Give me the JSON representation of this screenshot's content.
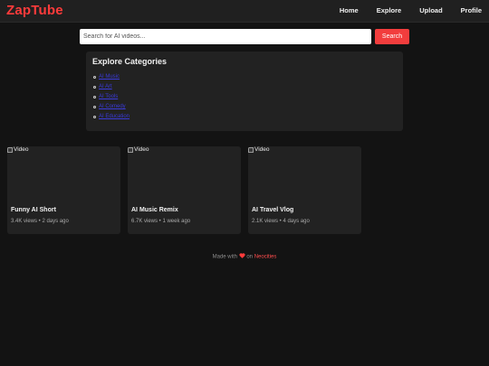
{
  "header": {
    "logo": "ZapTube",
    "nav": [
      "Home",
      "Explore",
      "Upload",
      "Profile"
    ]
  },
  "search": {
    "placeholder": "Search for AI videos...",
    "value": "",
    "button_label": "Search"
  },
  "categories": {
    "title": "Explore Categories",
    "items": [
      "AI Music",
      "AI Art",
      "AI Tools",
      "AI Comedy",
      "AI Education"
    ]
  },
  "videos": [
    {
      "thumbnail_alt": "Video",
      "title": "Funny AI Short",
      "meta": "3.4K views • 2 days ago"
    },
    {
      "thumbnail_alt": "Video",
      "title": "AI Music Remix",
      "meta": "6.7K views • 1 week ago"
    },
    {
      "thumbnail_alt": "Video",
      "title": "AI Travel Vlog",
      "meta": "2.1K views • 4 days ago"
    }
  ],
  "footer": {
    "prefix": "Made with",
    "heart_icon": "heart-icon",
    "middle": "on",
    "link_text": "Neocities"
  },
  "colors": {
    "accent": "#f23d3d",
    "background": "#131313",
    "panel": "#222222"
  }
}
